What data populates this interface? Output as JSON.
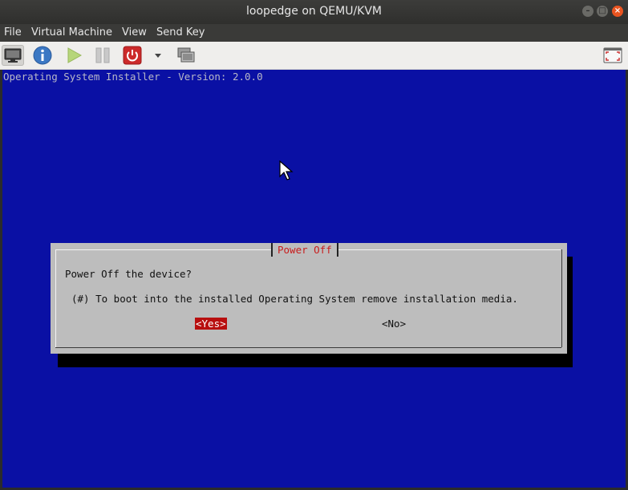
{
  "window": {
    "title": "loopedge on QEMU/KVM"
  },
  "menu": {
    "file": "File",
    "virtual_machine": "Virtual Machine",
    "view": "View",
    "send_key": "Send Key"
  },
  "console": {
    "header": "Operating System Installer - Version: 2.0.0",
    "dialog": {
      "title": "Power Off",
      "question": "Power Off the device?",
      "note": "(#) To boot into the installed Operating System remove installation media.",
      "yes": "<Yes>",
      "no": "<No>"
    }
  },
  "colors": {
    "console_bg": "#0a10a4",
    "dialog_bg": "#bdbdbd",
    "accent_red": "#b80f0f"
  },
  "icons": [
    "monitor-icon",
    "info-icon",
    "play-icon",
    "pause-icon",
    "power-icon",
    "dropdown-arrow-icon",
    "snapshots-icon",
    "fullscreen-icon"
  ]
}
